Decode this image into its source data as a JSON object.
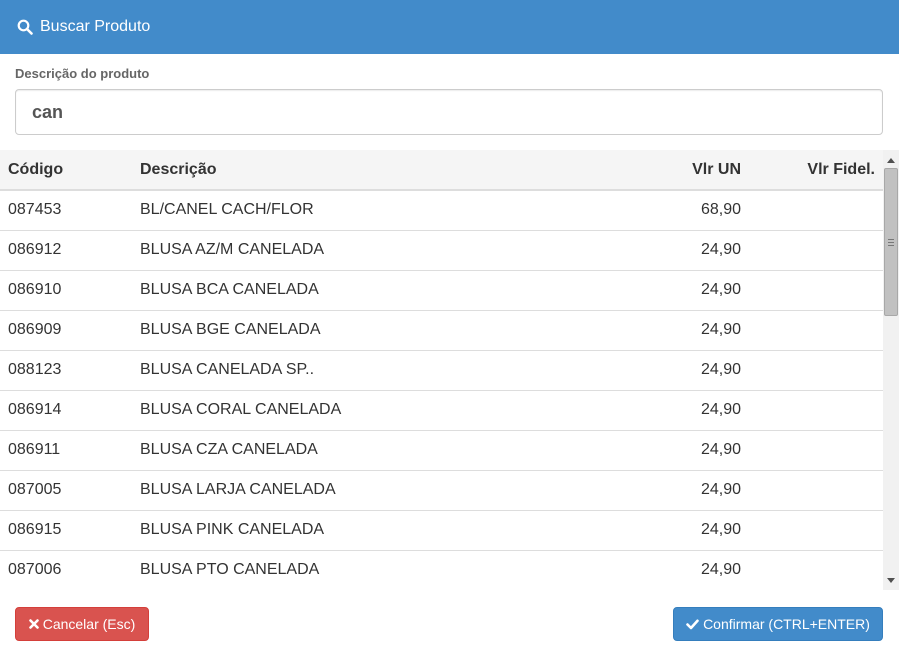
{
  "modal": {
    "title": "Buscar Produto",
    "title_icon": "search-icon"
  },
  "search": {
    "label": "Descrição do produto",
    "value": "can"
  },
  "table": {
    "headers": {
      "codigo": "Código",
      "descricao": "Descrição",
      "vlr_un": "Vlr UN",
      "vlr_fidel": "Vlr Fidel."
    },
    "rows": [
      {
        "codigo": "087453",
        "descricao": "BL/CANEL CACH/FLOR",
        "vlr_un": "68,90",
        "vlr_fidel": ""
      },
      {
        "codigo": "086912",
        "descricao": "BLUSA AZ/M CANELADA",
        "vlr_un": "24,90",
        "vlr_fidel": ""
      },
      {
        "codigo": "086910",
        "descricao": "BLUSA BCA CANELADA",
        "vlr_un": "24,90",
        "vlr_fidel": ""
      },
      {
        "codigo": "086909",
        "descricao": "BLUSA BGE CANELADA",
        "vlr_un": "24,90",
        "vlr_fidel": ""
      },
      {
        "codigo": "088123",
        "descricao": "BLUSA CANELADA SP..",
        "vlr_un": "24,90",
        "vlr_fidel": ""
      },
      {
        "codigo": "086914",
        "descricao": "BLUSA CORAL CANELADA",
        "vlr_un": "24,90",
        "vlr_fidel": ""
      },
      {
        "codigo": "086911",
        "descricao": "BLUSA CZA CANELADA",
        "vlr_un": "24,90",
        "vlr_fidel": ""
      },
      {
        "codigo": "087005",
        "descricao": "BLUSA LARJA CANELADA",
        "vlr_un": "24,90",
        "vlr_fidel": ""
      },
      {
        "codigo": "086915",
        "descricao": "BLUSA PINK CANELADA",
        "vlr_un": "24,90",
        "vlr_fidel": ""
      },
      {
        "codigo": "087006",
        "descricao": "BLUSA PTO CANELADA",
        "vlr_un": "24,90",
        "vlr_fidel": ""
      },
      {
        "codigo": "",
        "descricao": "",
        "vlr_un": "",
        "vlr_fidel": ""
      }
    ]
  },
  "footer": {
    "cancel_label": "Cancelar (Esc)",
    "cancel_icon": "close-icon",
    "confirm_label": "Confirmar (CTRL+ENTER)",
    "confirm_icon": "check-icon"
  },
  "colors": {
    "primary": "#428bca",
    "danger": "#d9534f"
  }
}
